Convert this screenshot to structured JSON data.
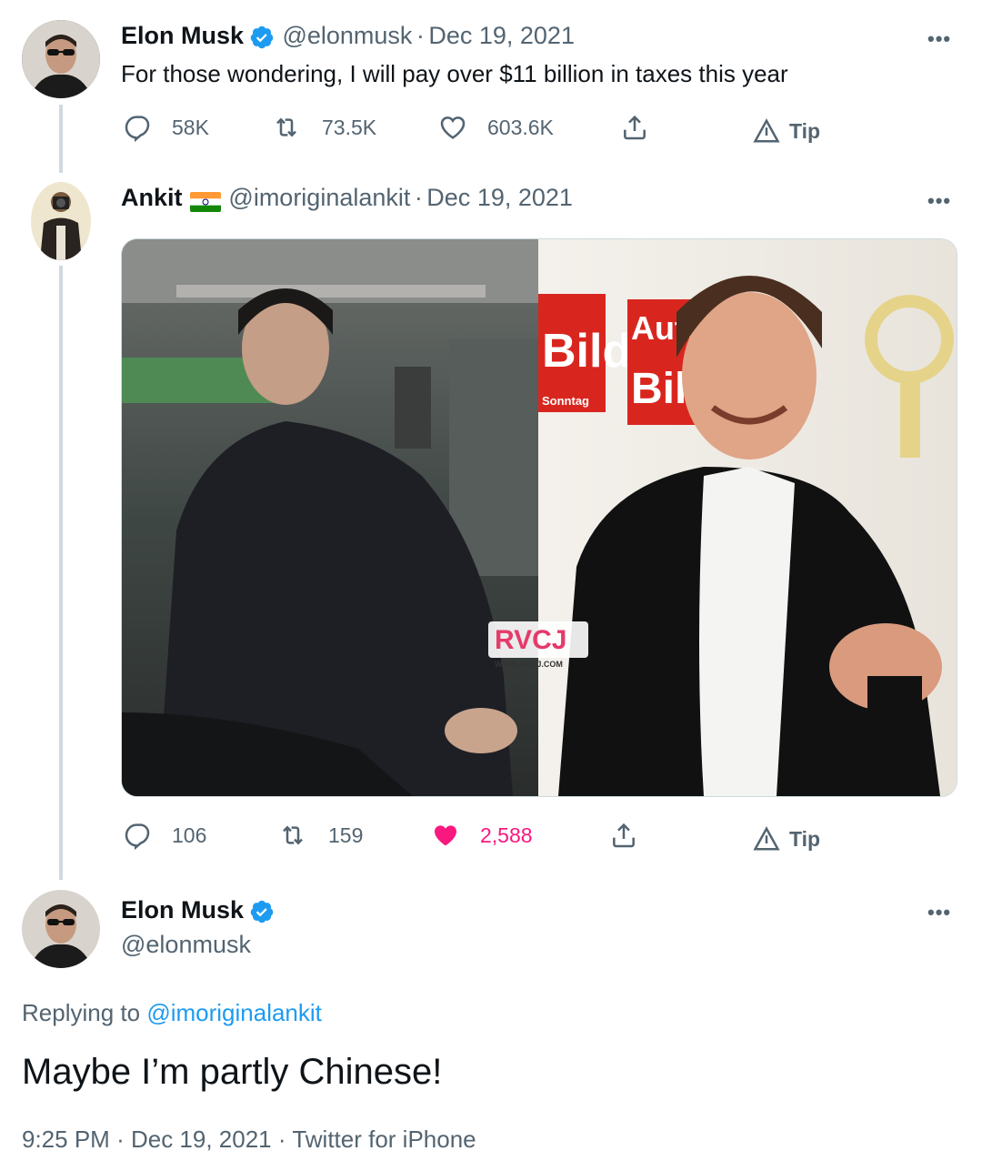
{
  "tweet1": {
    "name": "Elon Musk",
    "handle": "@elonmusk",
    "date": "Dec 19, 2021",
    "text": "For those wondering, I will pay over $11 billion in taxes this year",
    "replies": "58K",
    "retweets": "73.5K",
    "likes": "603.6K",
    "tip": "Tip"
  },
  "tweet2": {
    "name": "Ankit",
    "flag_icon": "india-flag-icon",
    "handle": "@imoriginalankit",
    "date": "Dec 19, 2021",
    "replies": "106",
    "retweets": "159",
    "likes": "2,588",
    "tip": "Tip",
    "media": {
      "watermark": "RVCJ",
      "watermark_url": "WWW.RVCJ.COM",
      "sign_text_1": "Bild",
      "sign_text_2": "Sonntag",
      "sign_text_3": "Auto",
      "sign_text_4": "Bild"
    }
  },
  "main_tweet": {
    "name": "Elon Musk",
    "handle": "@elonmusk",
    "replying_prefix": "Replying to",
    "replying_handle": "@imoriginalankit",
    "text": "Maybe I’m partly Chinese!",
    "time": "9:25 PM",
    "date": "Dec 19, 2021",
    "source": "Twitter for iPhone"
  },
  "separator": "·",
  "more_glyph": "•••",
  "colors": {
    "accent": "#1d9bf0",
    "like": "#f91880",
    "muted": "#536471",
    "text": "#0f1419"
  }
}
